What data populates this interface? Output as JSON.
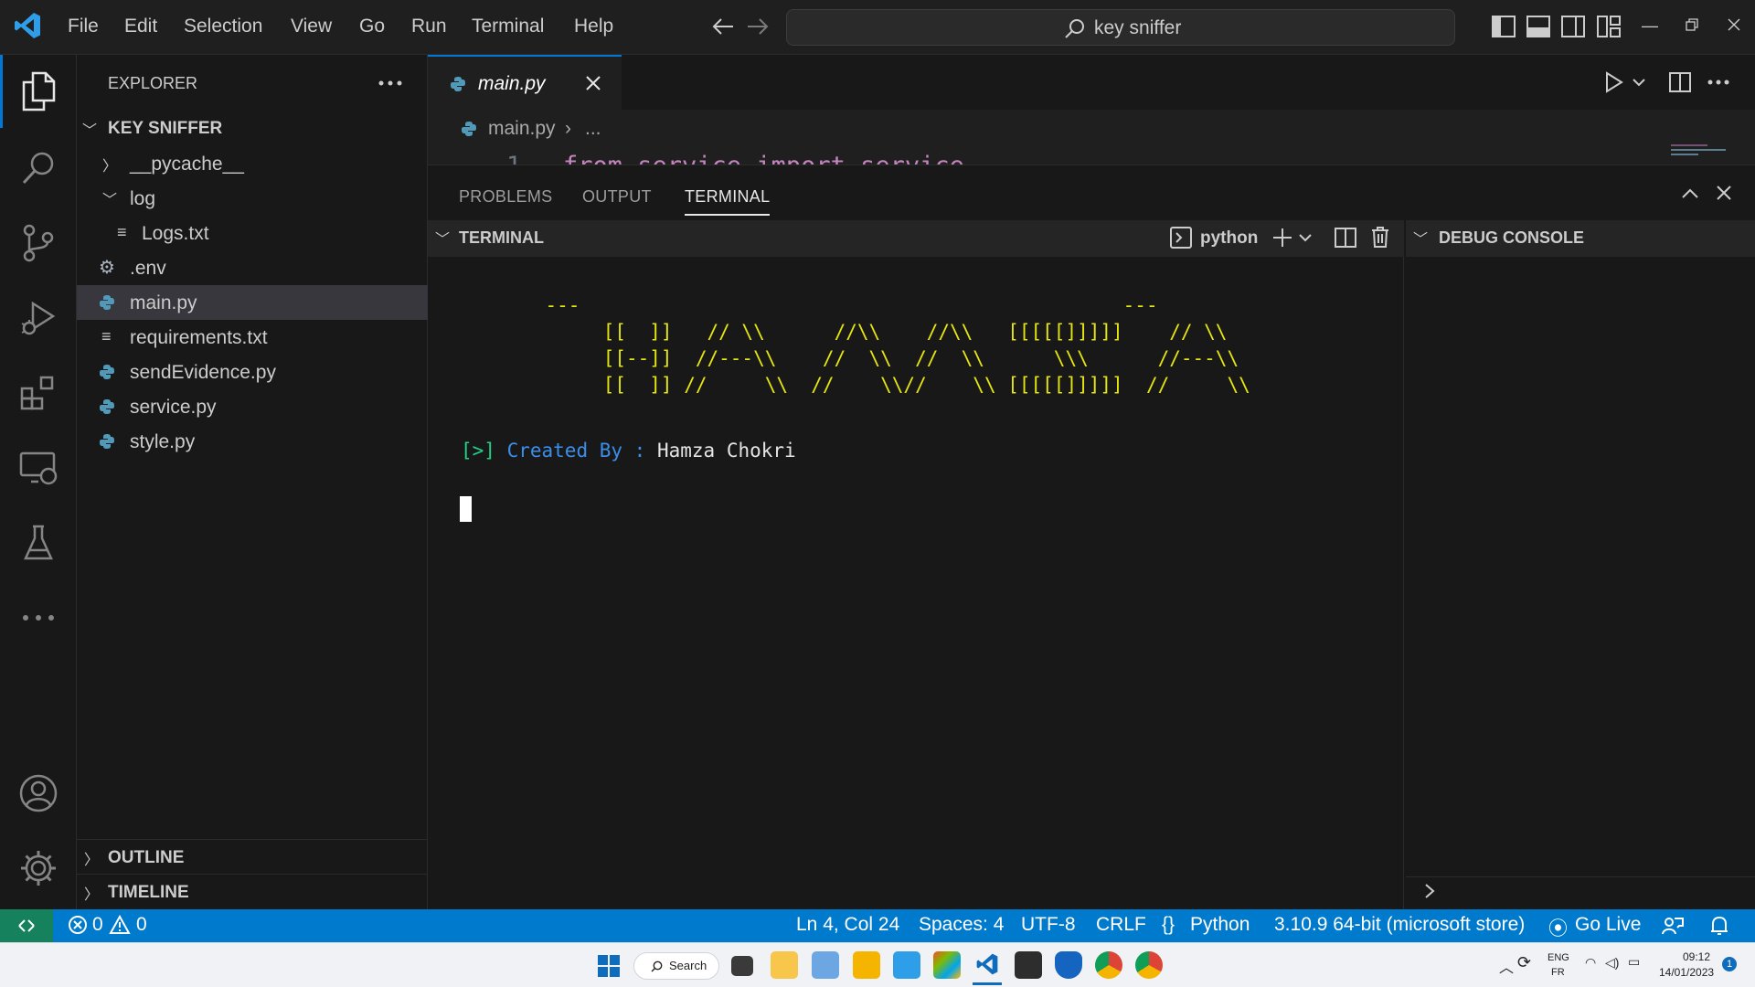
{
  "menu": [
    "File",
    "Edit",
    "Selection",
    "View",
    "Go",
    "Run",
    "Terminal",
    "Help"
  ],
  "search": {
    "text": "key sniffer"
  },
  "explorer": {
    "title": "EXPLORER",
    "root": "KEY SNIFFER",
    "items": [
      {
        "label": "__pycache__",
        "type": "folder-closed"
      },
      {
        "label": "log",
        "type": "folder-open"
      },
      {
        "label": "Logs.txt",
        "type": "text"
      },
      {
        "label": ".env",
        "type": "gear"
      },
      {
        "label": "main.py",
        "type": "python",
        "selected": true
      },
      {
        "label": "requirements.txt",
        "type": "text"
      },
      {
        "label": "sendEvidence.py",
        "type": "python"
      },
      {
        "label": "service.py",
        "type": "python"
      },
      {
        "label": "style.py",
        "type": "python"
      }
    ],
    "outline": "OUTLINE",
    "timeline": "TIMELINE"
  },
  "editor": {
    "tab_label": "main.py",
    "breadcrumb_file": "main.py",
    "breadcrumb_rest": "...",
    "line_number": "1",
    "code_line": "from service import service"
  },
  "panel": {
    "tabs": [
      "PROBLEMS",
      "OUTPUT",
      "TERMINAL"
    ],
    "terminal_title": "TERMINAL",
    "shell": "python",
    "debug_title": "DEBUG CONSOLE",
    "ascii_art": "       ---                                               ---\n            [[  ]]   // \\\\      //\\\\    //\\\\   [[[[[]]]]]    // \\\\\n            [[--]]  //---\\\\    //  \\\\  //  \\\\      \\\\\\      //---\\\\\n            [[  ]] //     \\\\  //    \\\\//    \\\\ [[[[[]]]]]  //     \\\\",
    "prompt_prefix": "[>]",
    "created_by": "Created By :",
    "author": "Hamza Chokri"
  },
  "status": {
    "errors": "0",
    "warnings": "0",
    "position": "Ln 4, Col 24",
    "spaces": "Spaces: 4",
    "encoding": "UTF-8",
    "eol": "CRLF",
    "language": "Python",
    "interpreter": "3.10.9 64-bit (microsoft store)",
    "golive": "Go Live"
  },
  "taskbar": {
    "search": "Search",
    "lang_top": "ENG",
    "lang_bottom": "FR",
    "time": "09:12",
    "date": "14/01/2023",
    "notif": "1"
  },
  "colors": {
    "accent": "#007acc",
    "terminal_yellow": "#e5e510",
    "terminal_blue": "#3b8eea",
    "terminal_green": "#23d18b"
  }
}
